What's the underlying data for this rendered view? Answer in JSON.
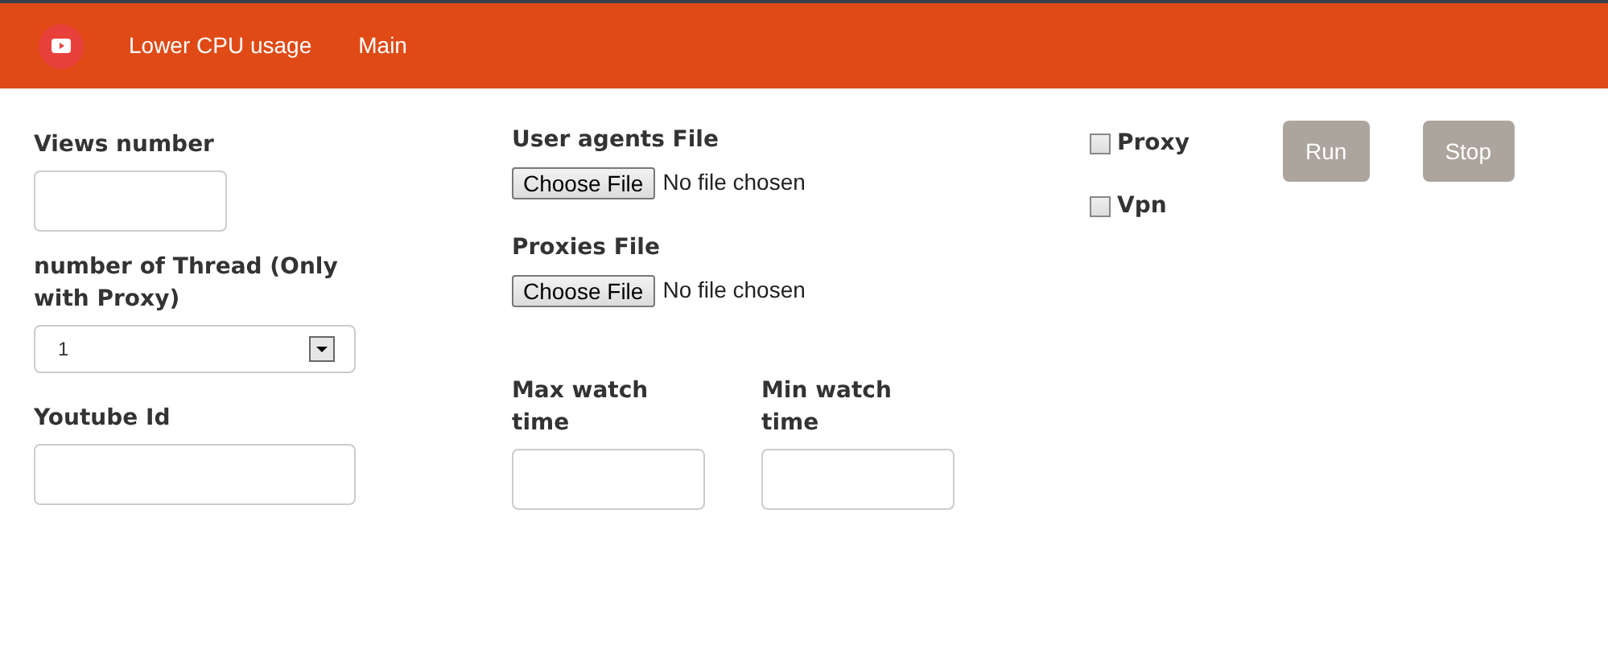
{
  "navbar": {
    "links": [
      {
        "label": "Lower CPU usage"
      },
      {
        "label": "Main"
      }
    ]
  },
  "views_number": {
    "label": "Views number"
  },
  "threads": {
    "label": "number of Thread (Only with Proxy)",
    "value": "1"
  },
  "youtube_id": {
    "label": "Youtube Id"
  },
  "user_agents_file": {
    "label": "User agents File",
    "button": "Choose File",
    "status": "No file chosen"
  },
  "proxies_file": {
    "label": "Proxies File",
    "button": "Choose File",
    "status": "No file chosen"
  },
  "max_watch_time": {
    "label": "Max watch time"
  },
  "min_watch_time": {
    "label": "Min watch time"
  },
  "options": [
    {
      "label": "Proxy",
      "checked": false
    },
    {
      "label": "Vpn",
      "checked": false
    }
  ],
  "buttons": [
    {
      "label": "Run"
    },
    {
      "label": "Stop"
    }
  ]
}
